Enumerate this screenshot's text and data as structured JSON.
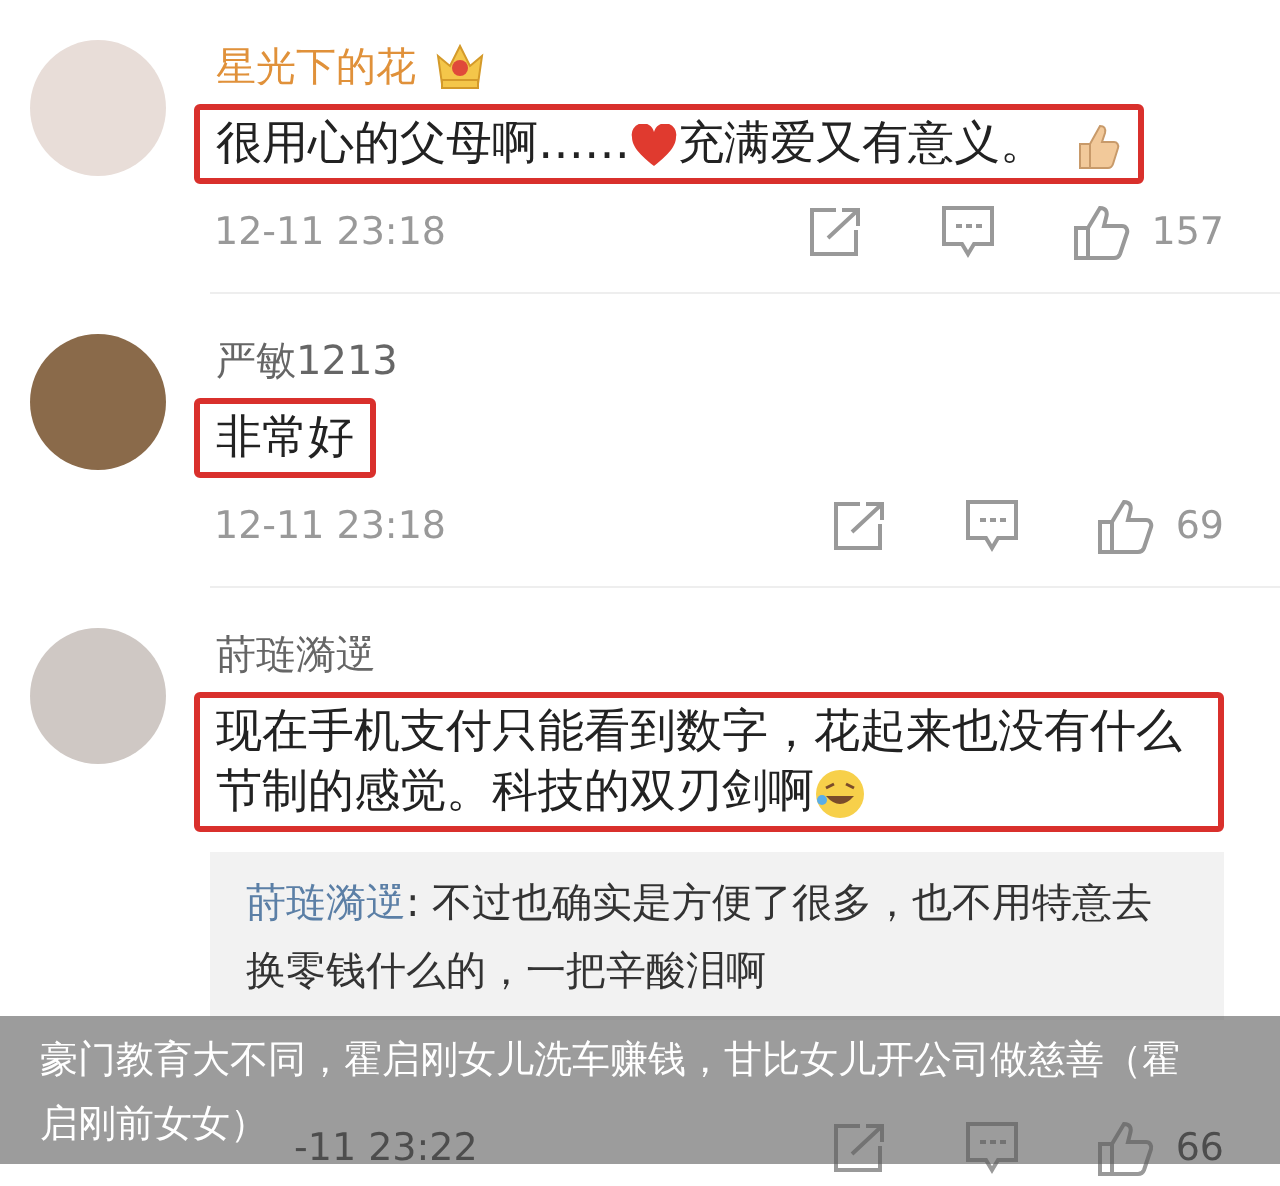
{
  "comments": [
    {
      "kind": "vip",
      "name": "星光下的花",
      "highlighted": true,
      "segments": [
        {
          "kind": "text",
          "text": "很用心的父母啊……"
        },
        {
          "kind": "heart"
        },
        {
          "kind": "text",
          "text": "充满爱又有意义。"
        },
        {
          "kind": "thumbs"
        }
      ],
      "time": "12-11 23:18",
      "likes": "157"
    },
    {
      "kind": "normal",
      "name": "严敏1213",
      "highlighted": true,
      "segments": [
        {
          "kind": "text",
          "text": "非常好"
        }
      ],
      "time": "12-11 23:18",
      "likes": "69"
    },
    {
      "kind": "normal",
      "name": "莳琏漪遻",
      "highlighted": true,
      "segments": [
        {
          "kind": "text",
          "text": "现在手机支付只能看到数字，花起来也没有什么节制的感觉。科技的双刃剑啊"
        },
        {
          "kind": "laugh"
        }
      ],
      "reply": {
        "name": "莳琏漪遻",
        "text": ": 不过也确实是方便了很多，也不用特意去换零钱什么的，一把辛酸泪啊"
      },
      "time": "-11 23:22",
      "likes": "66"
    }
  ],
  "caption_lines": [
    "豪门教育大不同，霍启刚女儿洗车赚钱，甘比女儿开公司做慈善（霍",
    "启刚前女女）"
  ]
}
